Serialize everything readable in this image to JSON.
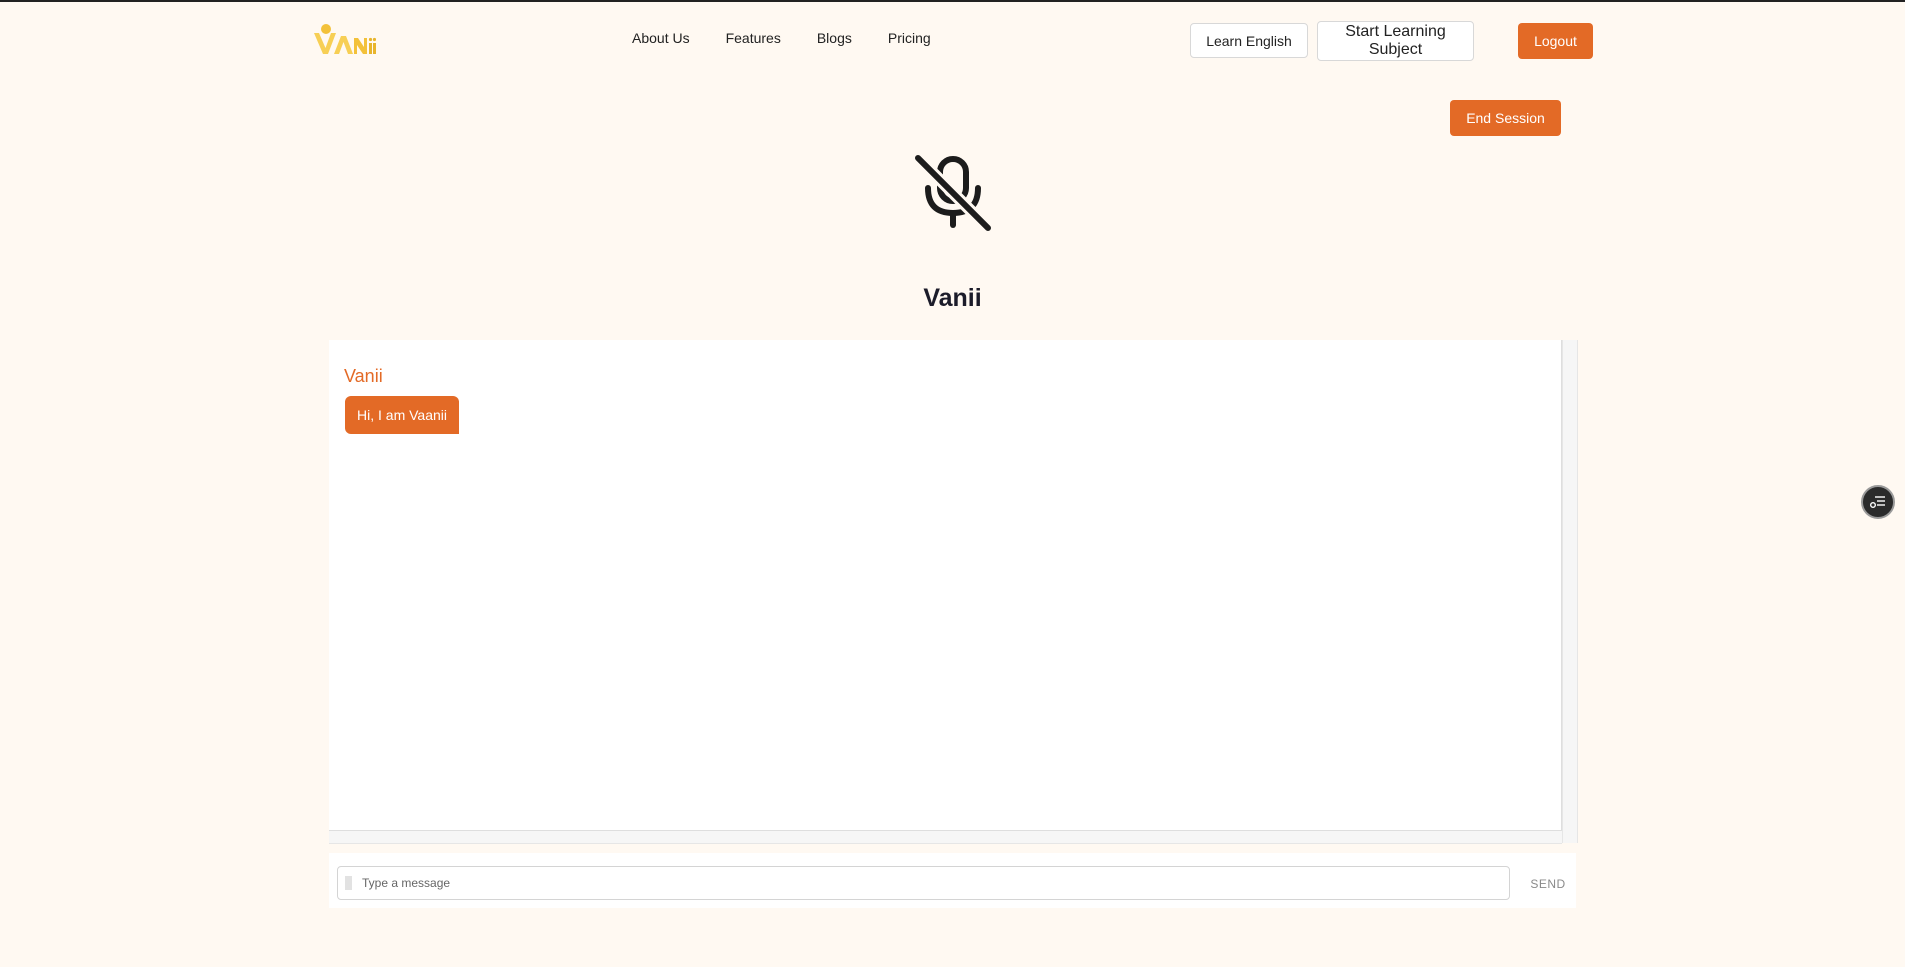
{
  "brand": {
    "logo_text": "VAnii",
    "logo_color": "#f3c13a"
  },
  "nav": {
    "items": [
      "About Us",
      "Features",
      "Blogs",
      "Pricing"
    ]
  },
  "header_actions": {
    "learn_english": "Learn English",
    "start_learning_subject": "Start Learning Subject",
    "logout": "Logout"
  },
  "session": {
    "end_session": "End Session",
    "mic_status_icon": "mic-off-icon"
  },
  "assistant": {
    "title": "Vanii"
  },
  "chat": {
    "messages": [
      {
        "sender": "Vanii",
        "text": "Hi, I am Vaanii"
      }
    ]
  },
  "composer": {
    "placeholder": "Type a message",
    "send_label": "SEND"
  },
  "floating": {
    "icon": "menu-list-icon"
  },
  "colors": {
    "accent": "#e36a26",
    "background": "#fff9f2"
  }
}
